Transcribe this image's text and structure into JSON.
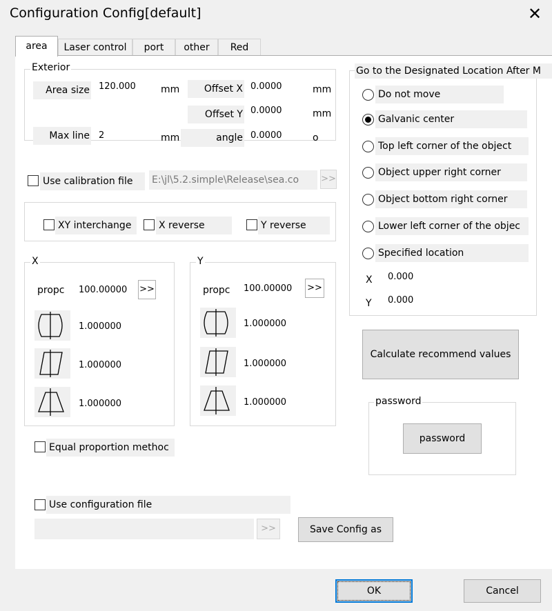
{
  "window": {
    "title": "Configuration Config[default]"
  },
  "tabs": [
    "area",
    "Laser control",
    "port",
    "other",
    "Red"
  ],
  "exterior": {
    "label": "Exterior",
    "area_size_label": "Area size",
    "area_size_value": "120.000",
    "area_size_unit": "mm",
    "offset_x_label": "Offset X",
    "offset_x_value": "0.0000",
    "offset_x_unit": "mm",
    "offset_y_label": "Offset Y",
    "offset_y_value": "0.0000",
    "offset_y_unit": "mm",
    "max_line_label": "Max line",
    "max_line_value": "2",
    "max_line_unit": "mm",
    "angle_label": "angle",
    "angle_value": "0.0000",
    "angle_unit": "o"
  },
  "calibration": {
    "checkbox_label": "Use calibration file",
    "path": "E:\\jl\\5.2.simple\\Release\\sea.co",
    "browse": ">>"
  },
  "transform": {
    "xy_interchange": "XY interchange",
    "x_reverse": "X reverse",
    "y_reverse": "Y reverse"
  },
  "x_group": {
    "label": "X",
    "prop_label": "propc",
    "prop_value": "100.00000",
    "browse": ">>",
    "v1": "1.000000",
    "v2": "1.000000",
    "v3": "1.000000"
  },
  "y_group": {
    "label": "Y",
    "prop_label": "propc",
    "prop_value": "100.00000",
    "browse": ">>",
    "v1": "1.000000",
    "v2": "1.000000",
    "v3": "1.000000"
  },
  "equal_proportion": "Equal proportion methoc",
  "location": {
    "label": "Go to the Designated Location After M",
    "options": [
      "Do not move",
      "Galvanic center",
      "Top left corner of the object",
      "Object upper right corner",
      "Object bottom right corner",
      "Lower left corner of the objec",
      "Specified location"
    ],
    "selected": 1,
    "x_label": "X",
    "x_value": "0.000",
    "y_label": "Y",
    "y_value": "0.000"
  },
  "calculate_button": "Calculate recommend values",
  "password": {
    "label": "password",
    "button": "password"
  },
  "config_file": {
    "checkbox_label": "Use configuration file",
    "browse": ">>",
    "save_button": "Save Config as"
  },
  "footer": {
    "ok": "OK",
    "cancel": "Cancel"
  }
}
